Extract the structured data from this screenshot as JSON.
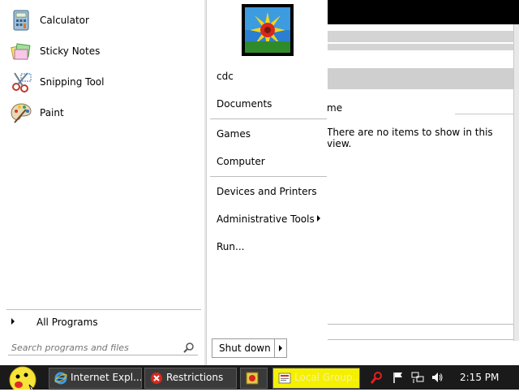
{
  "start_menu": {
    "programs": [
      {
        "label": "Calculator",
        "icon": "calculator-icon"
      },
      {
        "label": "Sticky Notes",
        "icon": "sticky-notes-icon"
      },
      {
        "label": "Snipping Tool",
        "icon": "scissors-icon"
      },
      {
        "label": "Paint",
        "icon": "paint-palette-icon"
      }
    ],
    "all_programs_label": "All Programs",
    "search_placeholder": "Search programs and files",
    "right_items": {
      "user": "cdc",
      "documents": "Documents",
      "games": "Games",
      "computer": "Computer",
      "devices": "Devices and Printers",
      "admin_tools": "Administrative Tools",
      "run": "Run..."
    },
    "shutdown_label": "Shut down"
  },
  "background_window": {
    "column_header_fragment": "me",
    "empty_message": "There are no items to show in this view."
  },
  "taskbar": {
    "buttons": [
      {
        "label": "Internet Expl...",
        "icon": "internet-explorer-icon"
      },
      {
        "label": "Restrictions",
        "icon": "error-icon"
      },
      {
        "label": "",
        "icon": "app-icon"
      },
      {
        "label": "Local Group...",
        "icon": "group-policy-icon"
      }
    ],
    "clock": "2:15 PM"
  },
  "colors": {
    "taskbar": "#1a1a1a",
    "highlight_yellow": "#f5f000"
  }
}
